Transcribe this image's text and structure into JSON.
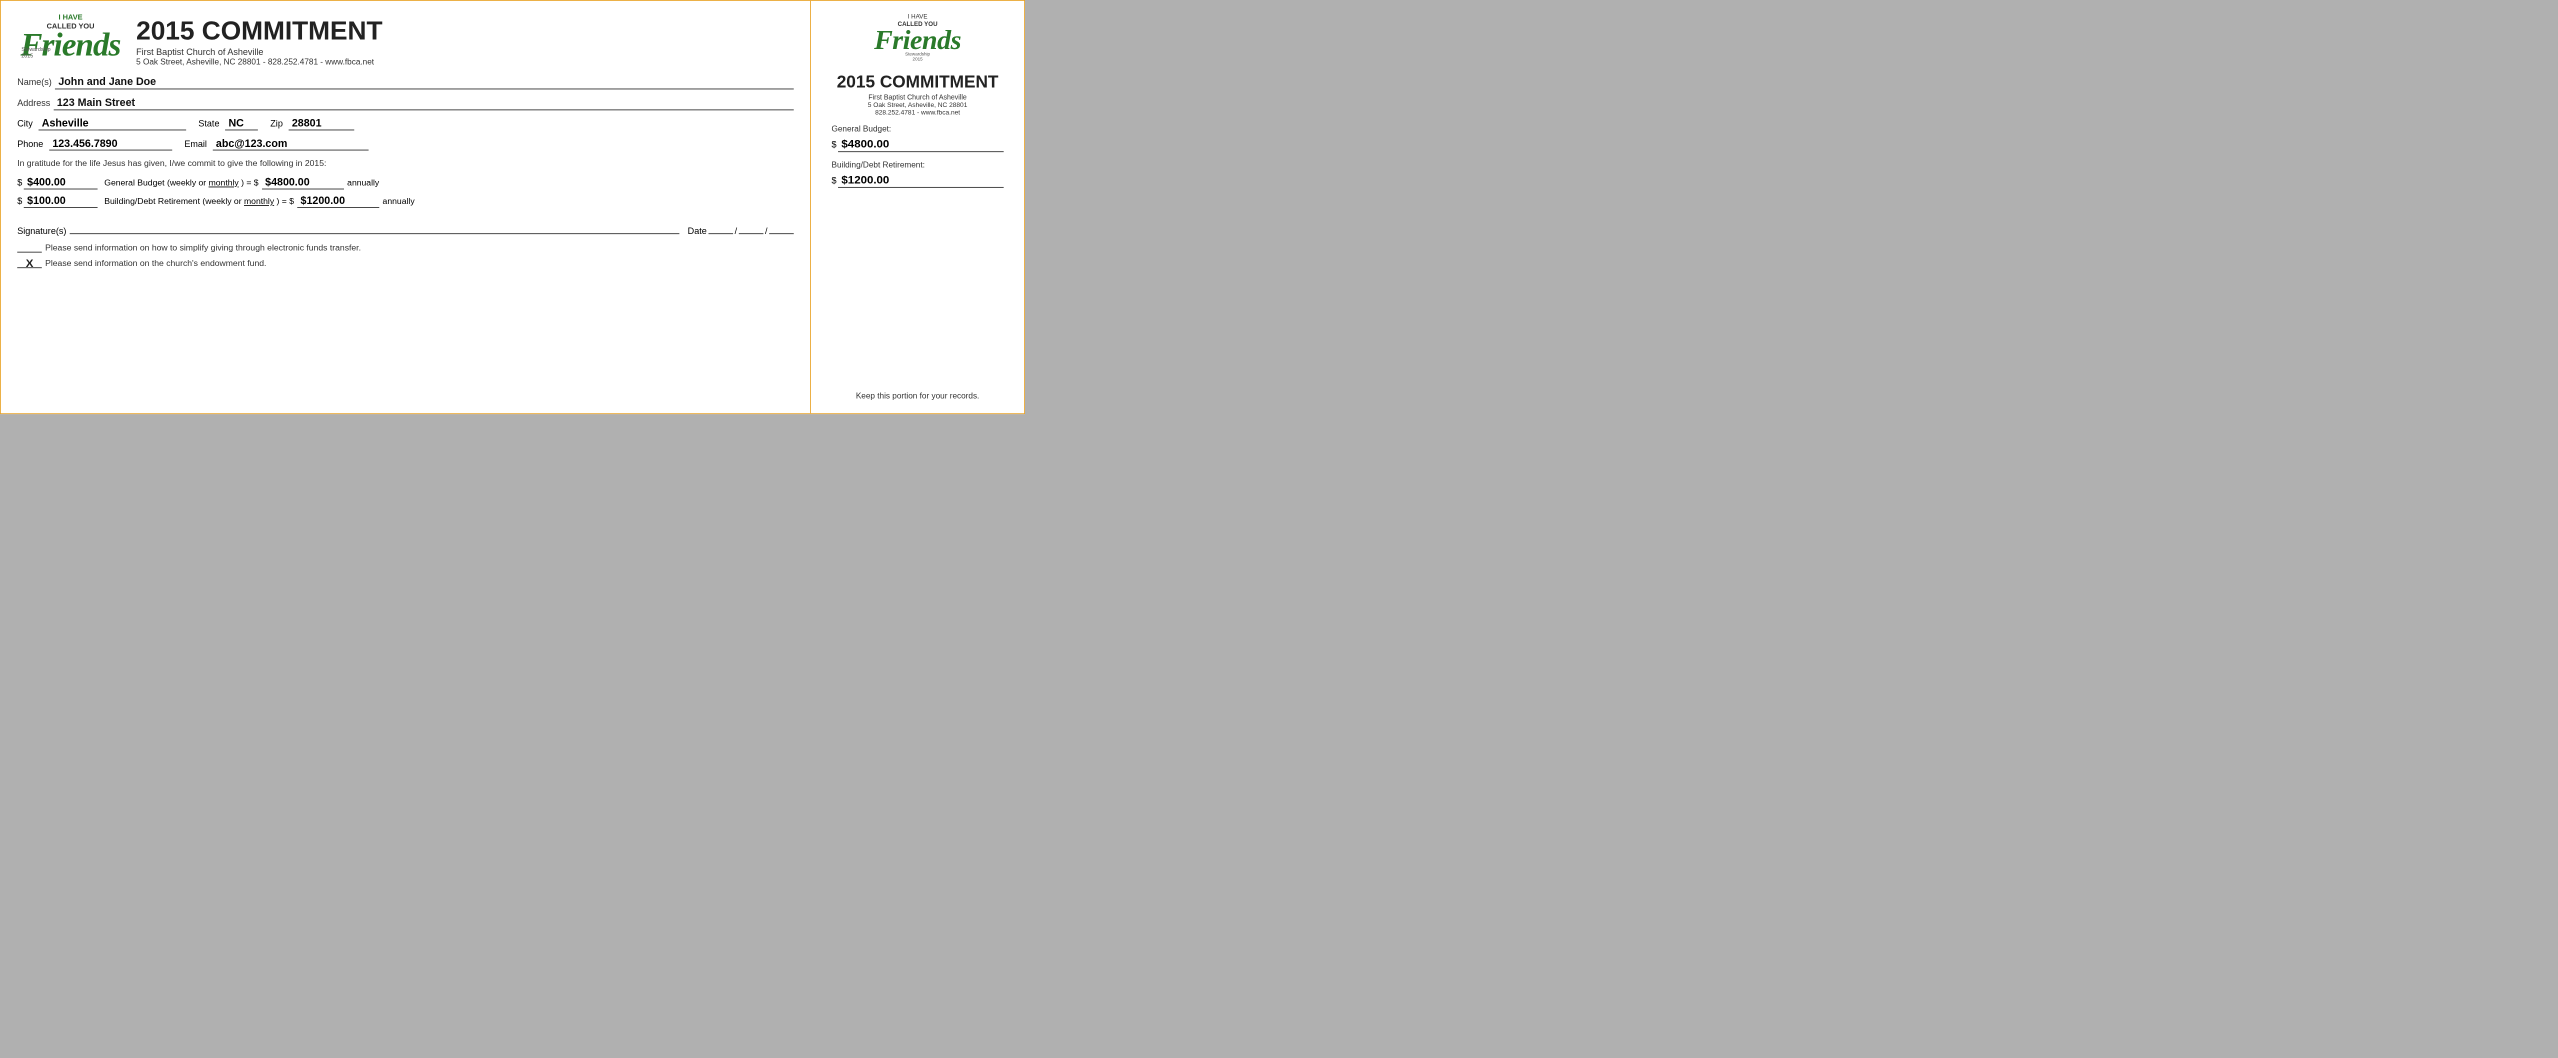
{
  "header": {
    "logo": {
      "top_line1": "I HAVE",
      "top_line2": "CALLED YOU",
      "friends": "Friends",
      "stewardship": "Stewardship\n2015"
    },
    "title": "2015 COMMITMENT",
    "church_name": "First Baptist Church of Asheville",
    "church_address": "5 Oak Street, Asheville, NC  28801 - 828.252.4781 - www.fbca.net"
  },
  "form": {
    "name_label": "Name(s)",
    "name_value": "John and Jane Doe",
    "address_label": "Address",
    "address_value": "123 Main Street",
    "city_label": "City",
    "city_value": "Asheville",
    "state_label": "State",
    "state_value": "NC",
    "zip_label": "Zip",
    "zip_value": "28801",
    "phone_label": "Phone",
    "phone_value": "123.456.7890",
    "email_label": "Email",
    "email_value": "abc@123.com",
    "commitment_text": "In gratitude for the life Jesus has given, I/we commit to give the following in 2015:",
    "general_budget": {
      "weekly_amount": "$400.00",
      "description": "General Budget (weekly or",
      "monthly_word": "monthly",
      "equals": ") = $",
      "annual_amount": "$4800.00",
      "annually": "annually"
    },
    "building_debt": {
      "weekly_amount": "$100.00",
      "description": "Building/Debt Retirement (weekly or",
      "monthly_word": "monthly",
      "equals": ") = $",
      "annual_amount": "$1200.00",
      "annually": "annually"
    },
    "signature_label": "Signature(s)",
    "date_label": "Date",
    "eft_checkbox": "",
    "eft_text": "Please send information on how to simplify giving through electronic funds transfer.",
    "endowment_checkbox": "X",
    "endowment_text": "Please send information on the church's endowment fund."
  },
  "stub": {
    "logo": {
      "top_line1": "I HAVE",
      "top_line2": "CALLED YOU",
      "friends": "Friends",
      "stewardship": "Stewardship\n2015"
    },
    "title": "2015 COMMITMENT",
    "church_name": "First Baptist Church of Asheville",
    "church_address": "5 Oak Street, Asheville, NC  28801",
    "church_contact": "828.252.4781 - www.fbca.net",
    "general_budget_label": "General Budget:",
    "general_budget_amount": "$4800.00",
    "building_debt_label": "Building/Debt Retirement:",
    "building_debt_amount": "$1200.00",
    "footer": "Keep this portion for your records."
  }
}
